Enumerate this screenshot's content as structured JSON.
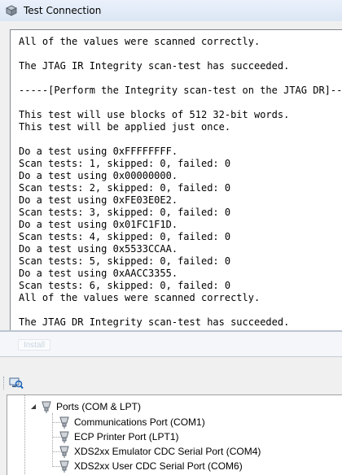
{
  "window": {
    "title": "Test Connection"
  },
  "console": {
    "lines": [
      "All of the values were scanned correctly.",
      "",
      "The JTAG IR Integrity scan-test has succeeded.",
      "",
      "-----[Perform the Integrity scan-test on the JTAG DR]----",
      "",
      "This test will use blocks of 512 32-bit words.",
      "This test will be applied just once.",
      "",
      "Do a test using 0xFFFFFFFF.",
      "Scan tests: 1, skipped: 0, failed: 0",
      "Do a test using 0x00000000.",
      "Scan tests: 2, skipped: 0, failed: 0",
      "Do a test using 0xFE03E0E2.",
      "Scan tests: 3, skipped: 0, failed: 0",
      "Do a test using 0x01FC1F1D.",
      "Scan tests: 4, skipped: 0, failed: 0",
      "Do a test using 0x5533CCAA.",
      "Scan tests: 5, skipped: 0, failed: 0",
      "Do a test using 0xAACC3355.",
      "Scan tests: 6, skipped: 0, failed: 0",
      "All of the values were scanned correctly.",
      "",
      "The JTAG DR Integrity scan-test has succeeded."
    ]
  },
  "device_manager": {
    "ghost_tab_label": "Install",
    "toolbar_icon": "scan-hardware-icon",
    "tree": {
      "category": {
        "label": "Ports (COM & LPT)",
        "expanded": true,
        "icon": "port-icon"
      },
      "devices": [
        {
          "label": "Communications Port (COM1)",
          "icon": "port-icon"
        },
        {
          "label": "ECP Printer Port (LPT1)",
          "icon": "port-icon"
        },
        {
          "label": "XDS2xx Emulator CDC Serial Port (COM4)",
          "icon": "port-icon"
        },
        {
          "label": "XDS2xx User CDC Serial Port (COM6)",
          "icon": "port-icon"
        }
      ]
    }
  }
}
